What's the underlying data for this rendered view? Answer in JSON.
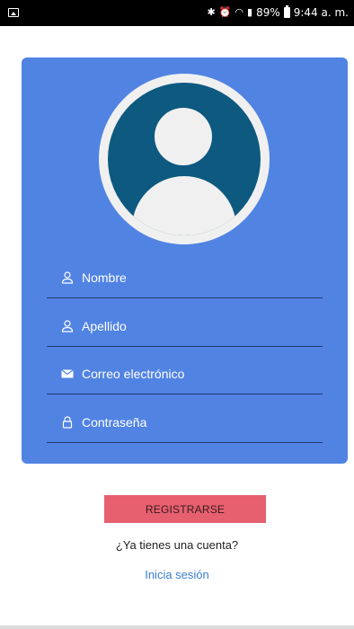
{
  "status_bar": {
    "right_text": "89%",
    "time": "9:44 a. m."
  },
  "form": {
    "fields": [
      {
        "label": "Nombre",
        "icon": "person-icon"
      },
      {
        "label": "Apellido",
        "icon": "person-icon"
      },
      {
        "label": "Correo electrónico",
        "icon": "mail-icon"
      },
      {
        "label": "Contraseña",
        "icon": "lock-icon"
      }
    ],
    "register_label": "REGISTRARSE",
    "account_question": "¿Ya tienes una cuenta?",
    "login_link": "Inicia sesión"
  },
  "colors": {
    "card": "#5183e3",
    "avatar": "#0d5980",
    "register_button": "#e6606f",
    "link": "#3a7dcf"
  }
}
